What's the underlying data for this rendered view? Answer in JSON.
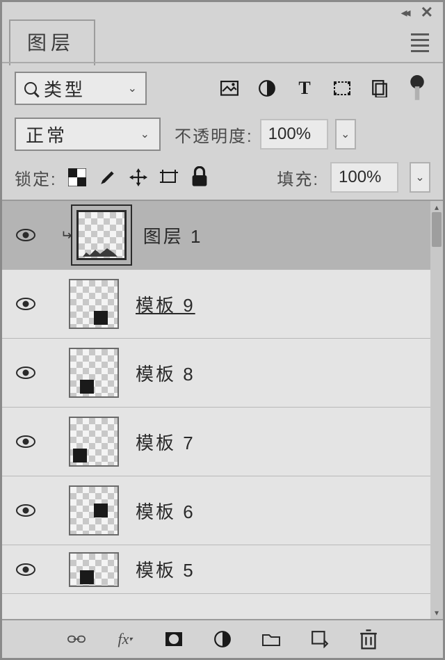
{
  "panel_title": "图层",
  "filter": {
    "label": "类型"
  },
  "blend": {
    "mode": "正常",
    "opacity_label": "不透明度:",
    "opacity_value": "100%"
  },
  "lock": {
    "label": "锁定:",
    "fill_label": "填充:",
    "fill_value": "100%"
  },
  "layers": [
    {
      "name": "图层 1",
      "selected": true
    },
    {
      "name": "模板 9"
    },
    {
      "name": "模板 8"
    },
    {
      "name": "模板 7"
    },
    {
      "name": "模板 6"
    },
    {
      "name": "模板 5"
    }
  ]
}
